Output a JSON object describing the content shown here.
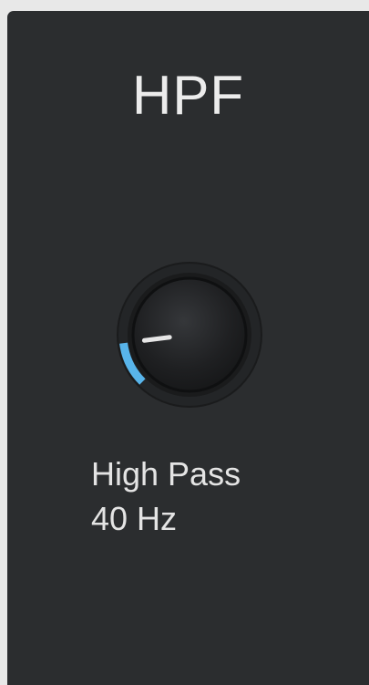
{
  "panel": {
    "title": "HPF",
    "knob": {
      "icon": "rotary-knob-icon",
      "label": "High Pass",
      "value_text": "40 Hz",
      "level": 0.14,
      "accent_color": "#58b4ea"
    }
  }
}
